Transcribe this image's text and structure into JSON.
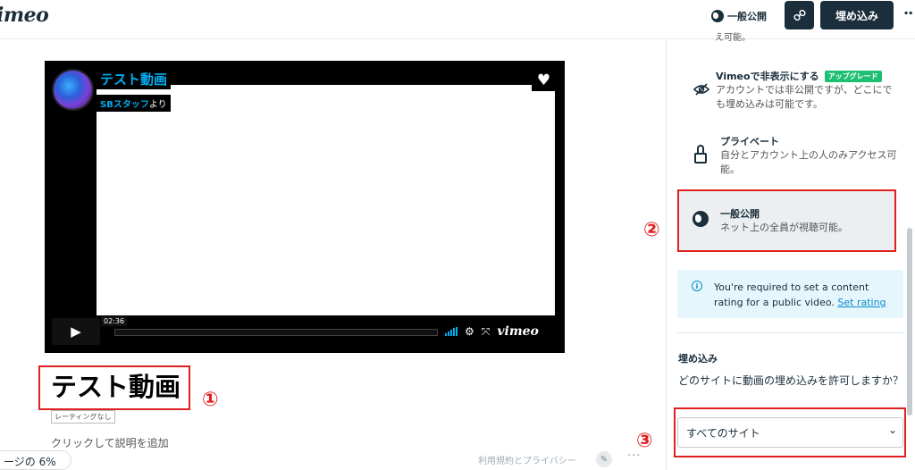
{
  "header": {
    "logo": "imeo",
    "privacy_label": "一般公開",
    "embed_label": "埋め込み",
    "more_glyph": "··"
  },
  "player": {
    "title": "テスト動画",
    "byline_user": "SBスタッフ",
    "byline_suffix": "より",
    "time": "02:36",
    "brand": "vimeo",
    "play_glyph": "▶",
    "heart_glyph": "♥"
  },
  "video": {
    "title": "テスト動画",
    "rating_tag": "レーティングなし",
    "description_prompt": "クリックして説明を追加"
  },
  "footer": {
    "storage": "ージの 6%",
    "terms_link": "利用規約とプライバシー",
    "more_glyph": "···"
  },
  "markers": [
    "①",
    "②",
    "③"
  ],
  "panel": {
    "cutoff_text": "え可能。",
    "options": [
      {
        "title": "Vimeoで非表示にする",
        "badge": "アップグレード",
        "desc": "アカウントでは非公開ですが、どこにでも埋め込みは可能です。"
      },
      {
        "title": "プライベート",
        "desc": "自分とアカウント上の人のみアクセス可能。"
      },
      {
        "title": "一般公開",
        "desc": "ネット上の全員が視聴可能。"
      }
    ],
    "info": {
      "text": "You're required to set a content rating for a public video.",
      "link": "Set rating"
    },
    "embed": {
      "heading": "埋め込み",
      "question": "どのサイトに動画の埋め込みを許可しますか？",
      "select_value": "すべてのサイト"
    }
  },
  "colors": {
    "accent": "#00adef",
    "highlight": "#e02020",
    "dark": "#1a2e3b",
    "upgrade": "#1dbf73"
  }
}
